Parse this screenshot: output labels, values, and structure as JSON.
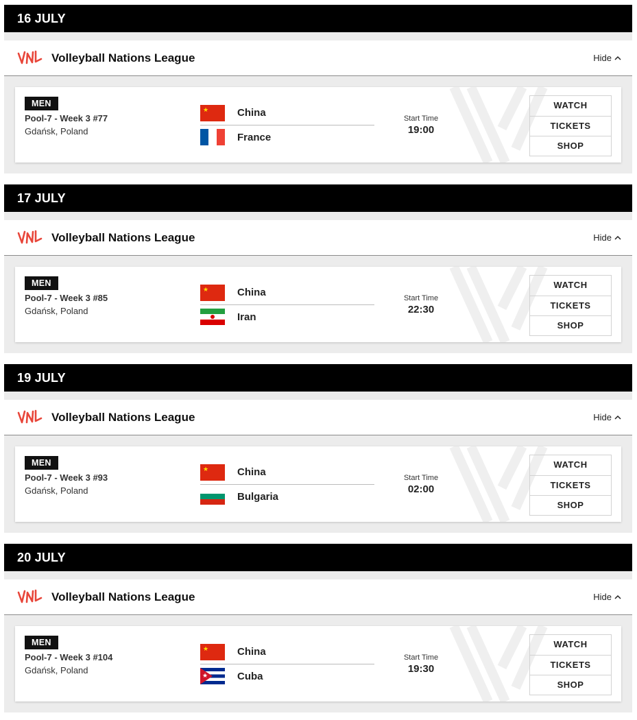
{
  "days": [
    {
      "date": "16 JULY",
      "league": "Volleyball Nations League",
      "hide_label": "Hide",
      "match": {
        "category": "MEN",
        "pool": "Pool-7 - Week 3 #77",
        "venue": "Gdańsk, Poland",
        "team1": "China",
        "team1_flag": "china",
        "team2": "France",
        "team2_flag": "france",
        "start_label": "Start Time",
        "start_time": "19:00",
        "actions": [
          "WATCH",
          "TICKETS",
          "SHOP"
        ]
      }
    },
    {
      "date": "17 JULY",
      "league": "Volleyball Nations League",
      "hide_label": "Hide",
      "match": {
        "category": "MEN",
        "pool": "Pool-7 - Week 3 #85",
        "venue": "Gdańsk, Poland",
        "team1": "China",
        "team1_flag": "china",
        "team2": "Iran",
        "team2_flag": "iran",
        "start_label": "Start Time",
        "start_time": "22:30",
        "actions": [
          "WATCH",
          "TICKETS",
          "SHOP"
        ]
      }
    },
    {
      "date": "19 JULY",
      "league": "Volleyball Nations League",
      "hide_label": "Hide",
      "match": {
        "category": "MEN",
        "pool": "Pool-7 - Week 3 #93",
        "venue": "Gdańsk, Poland",
        "team1": "China",
        "team1_flag": "china",
        "team2": "Bulgaria",
        "team2_flag": "bulgaria",
        "start_label": "Start Time",
        "start_time": "02:00",
        "actions": [
          "WATCH",
          "TICKETS",
          "SHOP"
        ]
      }
    },
    {
      "date": "20 JULY",
      "league": "Volleyball Nations League",
      "hide_label": "Hide",
      "match": {
        "category": "MEN",
        "pool": "Pool-7 - Week 3 #104",
        "venue": "Gdańsk, Poland",
        "team1": "China",
        "team1_flag": "china",
        "team2": "Cuba",
        "team2_flag": "cuba",
        "start_label": "Start Time",
        "start_time": "19:30",
        "actions": [
          "WATCH",
          "TICKETS",
          "SHOP"
        ]
      }
    }
  ],
  "colors": {
    "brand": "#e8463a",
    "date_bar": "#000000",
    "panel": "#ececec"
  }
}
